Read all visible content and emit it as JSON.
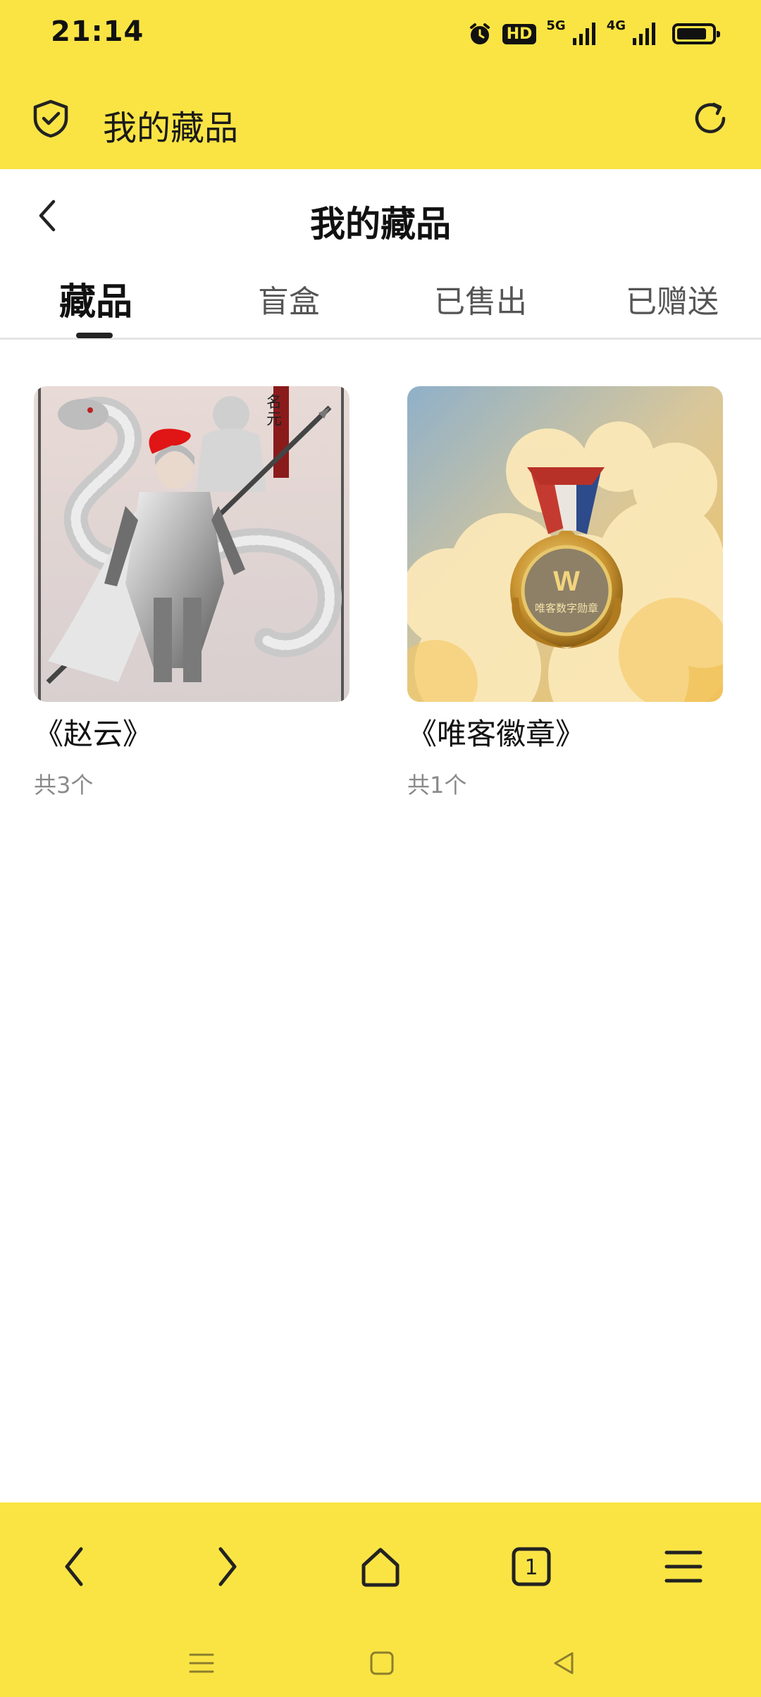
{
  "status_bar": {
    "time": "21:14",
    "hd_label": "HD",
    "net_5g": "5G",
    "net_4g": "4G",
    "battery_level": 0.85
  },
  "browser": {
    "title": "我的藏品",
    "shield_icon": "shield-check-icon",
    "refresh_icon": "refresh-icon"
  },
  "page": {
    "title": "我的藏品",
    "back_icon": "chevron-left-icon"
  },
  "tabs": [
    {
      "label": "藏品",
      "active": true
    },
    {
      "label": "盲盒",
      "active": false
    },
    {
      "label": "已售出",
      "active": false
    },
    {
      "label": "已赠送",
      "active": false
    }
  ],
  "collections": [
    {
      "name": "《赵云》",
      "count": "共3个",
      "image": "armored-warrior-with-dragon"
    },
    {
      "name": "《唯客徽章》",
      "count": "共1个",
      "image": "gold-medal-in-clouds",
      "medal_text": "唯客数字勋章",
      "medal_logo": "W"
    }
  ],
  "bottom_nav": {
    "tab_count": "1",
    "items": [
      "back-icon",
      "forward-icon",
      "home-icon",
      "tabs-icon",
      "menu-icon"
    ]
  },
  "colors": {
    "accent_yellow": "#fae444",
    "text_primary": "#111111",
    "text_secondary": "#8a8a8a"
  }
}
